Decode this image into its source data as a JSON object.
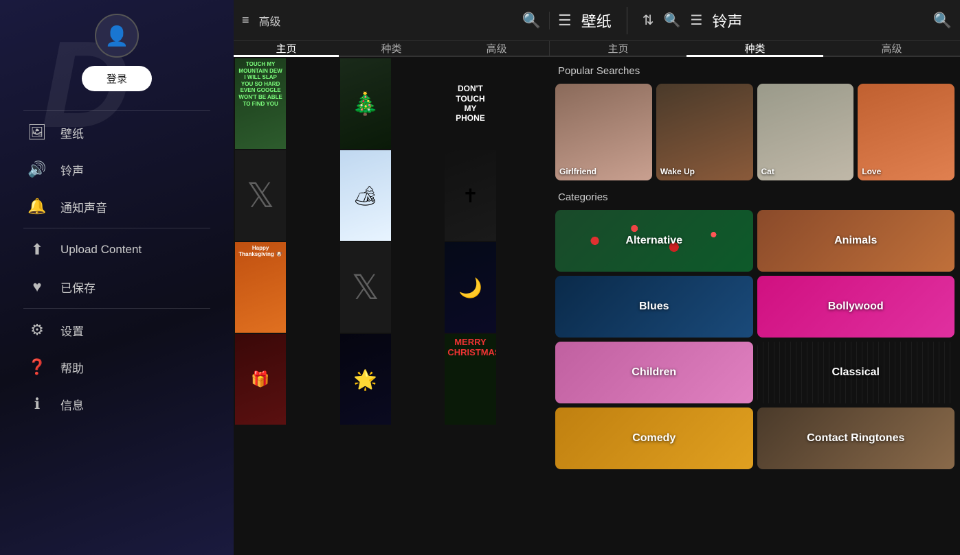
{
  "sidebar": {
    "bg_letter": "D",
    "login_label": "登录",
    "items": [
      {
        "id": "wallpaper",
        "label": "壁纸",
        "icon": "🖼"
      },
      {
        "id": "ringtone",
        "label": "铃声",
        "icon": "🔊"
      },
      {
        "id": "notification",
        "label": "通知声音",
        "icon": "🔔"
      },
      {
        "id": "upload",
        "label": "Upload Content",
        "icon": "⬆"
      },
      {
        "id": "saved",
        "label": "已保存",
        "icon": "♥"
      },
      {
        "id": "settings",
        "label": "设置",
        "icon": "⚙"
      },
      {
        "id": "help",
        "label": "帮助",
        "icon": "❓"
      },
      {
        "id": "info",
        "label": "信息",
        "icon": "ℹ"
      }
    ]
  },
  "wallpaper_panel": {
    "title": "壁纸",
    "filter_icon": "filter",
    "search_icon": "search",
    "tabs": [
      {
        "id": "home",
        "label": "主页",
        "active": true
      },
      {
        "id": "categories",
        "label": "种类",
        "active": false
      },
      {
        "id": "advanced",
        "label": "高级",
        "active": false
      }
    ],
    "top_bar": {
      "filter_label": "高级"
    }
  },
  "ringtone_panel": {
    "title": "铃声",
    "filter_icon": "filter",
    "search_icon": "search",
    "menu_icon": "menu",
    "global_search_icon": "search",
    "tabs": [
      {
        "id": "home",
        "label": "主页",
        "active": false
      },
      {
        "id": "categories",
        "label": "种类",
        "active": true
      },
      {
        "id": "advanced",
        "label": "高级",
        "active": false
      }
    ],
    "popular_searches": {
      "title": "Popular Searches",
      "items": [
        {
          "id": "girlfriend",
          "label": "Girlfriend"
        },
        {
          "id": "wakeup",
          "label": "Wake Up"
        },
        {
          "id": "cat",
          "label": "Cat"
        },
        {
          "id": "love",
          "label": "Love"
        }
      ]
    },
    "categories": {
      "title": "Categories",
      "items": [
        {
          "id": "alternative",
          "label": "Alternative"
        },
        {
          "id": "animals",
          "label": "Animals"
        },
        {
          "id": "blues",
          "label": "Blues"
        },
        {
          "id": "bollywood",
          "label": "Bollywood"
        },
        {
          "id": "children",
          "label": "Children"
        },
        {
          "id": "classical",
          "label": "Classical"
        },
        {
          "id": "comedy",
          "label": "Comedy"
        },
        {
          "id": "contact_ringtones",
          "label": "Contact Ringtones"
        }
      ]
    }
  },
  "wallpapers": [
    {
      "id": "wp1",
      "style": "wp-green",
      "text": "TOUCH MY MOUNTAIN DEW I WILL SLAP YOU SO HARD EVEN GOOGLE WON'T BE ABLE TO FIND YOU"
    },
    {
      "id": "wp2",
      "style": "wp-dark-yoda",
      "text": ""
    },
    {
      "id": "wp3",
      "style": "wp-dark-phone",
      "text": "DON'T TOUCH MY PHONE"
    },
    {
      "id": "wp4",
      "style": "wp-twitter-x",
      "text": ""
    },
    {
      "id": "wp5",
      "style": "wp-winter",
      "text": ""
    },
    {
      "id": "wp6",
      "style": "wp-dark-cross",
      "text": ""
    },
    {
      "id": "wp7",
      "style": "wp-orange-snoopy",
      "text": "Happy Thanksgiving"
    },
    {
      "id": "wp8",
      "style": "wp-xmas-door",
      "text": ""
    },
    {
      "id": "wp9",
      "style": "wp-dark-moon",
      "text": ""
    },
    {
      "id": "wp10",
      "style": "wp-xmas-text",
      "text": "MERRY CHRISTMAS"
    },
    {
      "id": "wp11",
      "style": "wp-placeholder",
      "text": ""
    },
    {
      "id": "wp12",
      "style": "wp-placeholder",
      "text": ""
    }
  ]
}
